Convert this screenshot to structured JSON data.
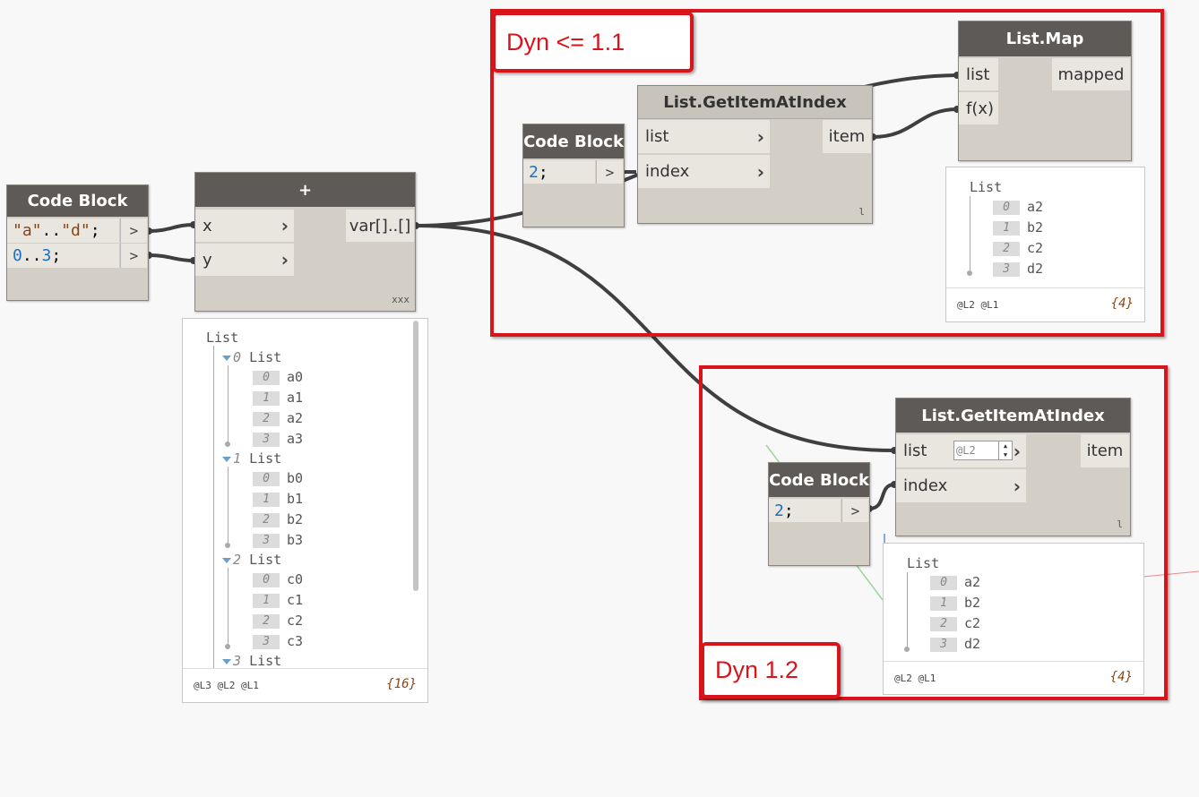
{
  "code_block_1": {
    "title": "Code Block",
    "line1": {
      "q1": "\"a\"",
      "dots": "..",
      "q2": "\"d\"",
      "semi": ";"
    },
    "line2": {
      "n1": "0",
      "dots": "..",
      "n2": "3",
      "semi": ";"
    },
    "out": ">"
  },
  "plus_node": {
    "title": "+",
    "in_x": "x",
    "in_y": "y",
    "out": "var[]..[]",
    "lacing": "xxx"
  },
  "big_preview": {
    "root": "List",
    "groups": [
      {
        "index": "0",
        "label": "List",
        "items": [
          {
            "i": "0",
            "v": "a0"
          },
          {
            "i": "1",
            "v": "a1"
          },
          {
            "i": "2",
            "v": "a2"
          },
          {
            "i": "3",
            "v": "a3"
          }
        ]
      },
      {
        "index": "1",
        "label": "List",
        "items": [
          {
            "i": "0",
            "v": "b0"
          },
          {
            "i": "1",
            "v": "b1"
          },
          {
            "i": "2",
            "v": "b2"
          },
          {
            "i": "3",
            "v": "b3"
          }
        ]
      },
      {
        "index": "2",
        "label": "List",
        "items": [
          {
            "i": "0",
            "v": "c0"
          },
          {
            "i": "1",
            "v": "c1"
          },
          {
            "i": "2",
            "v": "c2"
          },
          {
            "i": "3",
            "v": "c3"
          }
        ]
      },
      {
        "index": "3",
        "label": "List"
      }
    ],
    "levels": "@L3 @L2 @L1",
    "count": "{16}"
  },
  "dyn11": {
    "label": "Dyn <= 1.1",
    "code_block": {
      "title": "Code Block",
      "num": "2",
      "semi": ";",
      "out": ">"
    },
    "get_item": {
      "title": "List.GetItemAtIndex",
      "in_list": "list",
      "in_index": "index",
      "out": "item",
      "lacing": "l"
    },
    "list_map": {
      "title": "List.Map",
      "in_list": "list",
      "in_f": "f(x)",
      "out": "mapped"
    },
    "preview": {
      "root": "List",
      "items": [
        {
          "i": "0",
          "v": "a2"
        },
        {
          "i": "1",
          "v": "b2"
        },
        {
          "i": "2",
          "v": "c2"
        },
        {
          "i": "3",
          "v": "d2"
        }
      ],
      "levels": "@L2 @L1",
      "count": "{4}"
    }
  },
  "dyn12": {
    "label": "Dyn 1.2",
    "code_block": {
      "title": "Code Block",
      "num": "2",
      "semi": ";",
      "out": ">"
    },
    "get_item": {
      "title": "List.GetItemAtIndex",
      "in_list": "list",
      "level_value": "@L2",
      "in_index": "index",
      "out": "item",
      "lacing": "l"
    },
    "preview": {
      "root": "List",
      "items": [
        {
          "i": "0",
          "v": "a2"
        },
        {
          "i": "1",
          "v": "b2"
        },
        {
          "i": "2",
          "v": "c2"
        },
        {
          "i": "3",
          "v": "d2"
        }
      ],
      "levels": "@L2 @L1",
      "count": "{4}"
    }
  },
  "colors": {
    "node_header": "#5e5a57",
    "node_body": "#d3cfc6",
    "port_bg": "#e9e6e0",
    "highlight_red": "#d9141b",
    "wire": "#3f3f3f",
    "string_literal": "#8b4513",
    "number_literal": "#1e6fc4"
  }
}
